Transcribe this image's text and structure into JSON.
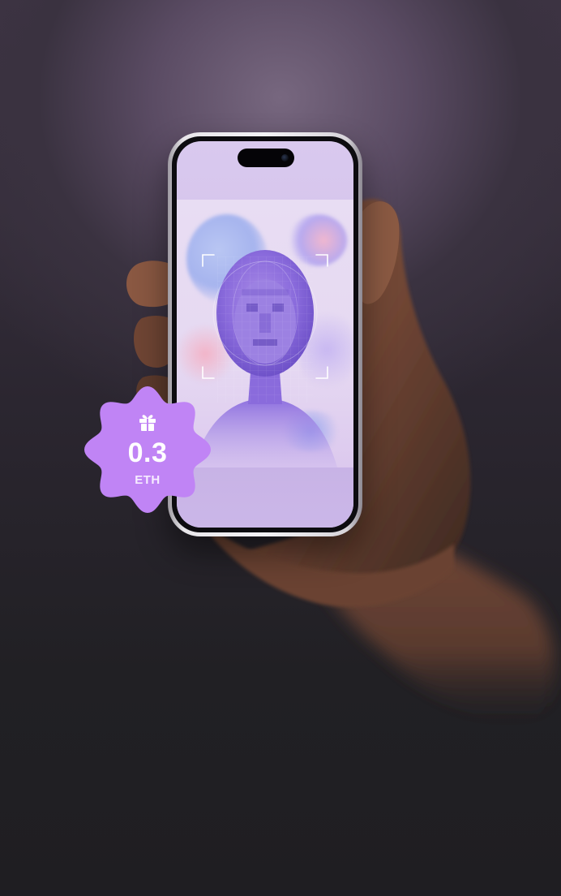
{
  "badge": {
    "value": "0.3",
    "unit": "ETH",
    "icon": "gift-icon",
    "color": "#c084f5"
  },
  "colors": {
    "background_top": "#6f5f78",
    "background_bottom": "#211f24",
    "screen_accent": "#cdb9e8",
    "face_accent": "#8a6be0"
  },
  "icons": [
    "gift-icon",
    "camera-icon",
    "face-scan-frame-icon"
  ]
}
